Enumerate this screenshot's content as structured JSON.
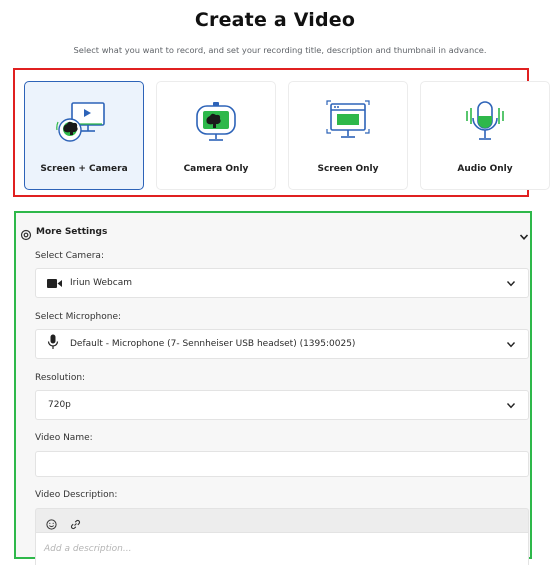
{
  "page": {
    "title": "Create a Video",
    "subtitle": "Select what you want to record, and set your recording title, description and thumbnail in advance."
  },
  "modes": [
    {
      "label": "Screen + Camera",
      "icon": "screen-camera-icon",
      "selected": true
    },
    {
      "label": "Camera Only",
      "icon": "camera-icon",
      "selected": false
    },
    {
      "label": "Screen Only",
      "icon": "screen-icon",
      "selected": false
    },
    {
      "label": "Audio Only",
      "icon": "microphone-icon",
      "selected": false
    }
  ],
  "settings": {
    "header": "More Settings",
    "camera": {
      "label": "Select Camera:",
      "value": "Iriun Webcam"
    },
    "microphone": {
      "label": "Select Microphone:",
      "value": "Default - Microphone (7- Sennheiser USB headset) (1395:0025)"
    },
    "resolution": {
      "label": "Resolution:",
      "value": "720p"
    },
    "video_name": {
      "label": "Video Name:",
      "value": ""
    },
    "video_description": {
      "label": "Video Description:",
      "placeholder": "Add a description..."
    }
  },
  "colors": {
    "accent": "#2d63b8",
    "selected_bg": "#ecf3fc",
    "icon_green": "#2eb84a",
    "annotation_red": "#e02020",
    "annotation_green": "#2eb84a"
  }
}
